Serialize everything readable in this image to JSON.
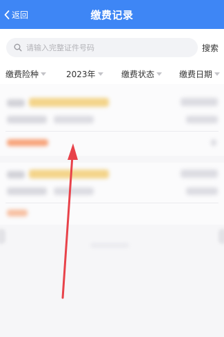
{
  "header": {
    "back_label": "返回",
    "title": "缴费记录"
  },
  "search": {
    "placeholder": "请输入完整证件号码",
    "value": "",
    "button_label": "搜索"
  },
  "filters": [
    {
      "label": "缴费险种"
    },
    {
      "label": "2023年"
    },
    {
      "label": "缴费状态"
    },
    {
      "label": "缴费日期"
    }
  ],
  "colors": {
    "header_bg": "#3e86f5",
    "annotation_arrow": "#e8424a",
    "blurred_accent_gold": "#f3d48a",
    "blurred_accent_orange": "#f7a37a"
  },
  "icons": {
    "back": "chevron-left-icon",
    "search": "search-icon",
    "filter_caret": "caret-down-icon"
  }
}
